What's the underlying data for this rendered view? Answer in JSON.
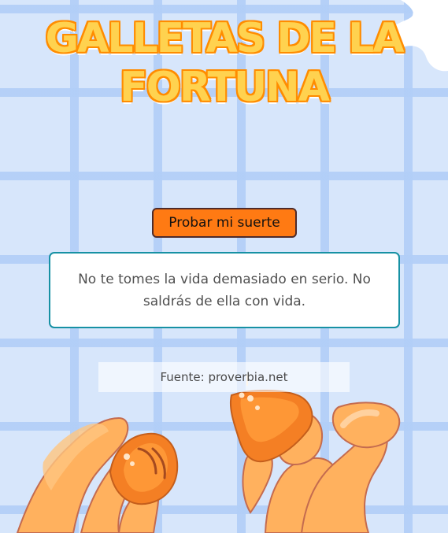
{
  "header": {
    "title_line_1": "GALLETAS DE LA",
    "title_line_2": "FORTUNA"
  },
  "actions": {
    "try_luck_label": "Probar mi suerte"
  },
  "fortune": {
    "quote": "No te tomes la vida demasiado en serio. No saldrás de ella con vida."
  },
  "source": {
    "text": "Fuente: proverbia.net"
  },
  "colors": {
    "background": "#d7e6fb",
    "grid": "#aecbf7",
    "title_fill": "#ffd24f",
    "title_outline": "#ff8c00",
    "button_fill": "#ff7a13",
    "card_border": "#1791a4",
    "hand_fill": "#ffaf5f",
    "cookie_fill": "#f47f24"
  },
  "icons": {
    "left_cookie": "fortune-cookie-half-icon",
    "right_cookie": "fortune-cookie-half-icon",
    "puzzle_shape": "puzzle-piece-icon"
  }
}
